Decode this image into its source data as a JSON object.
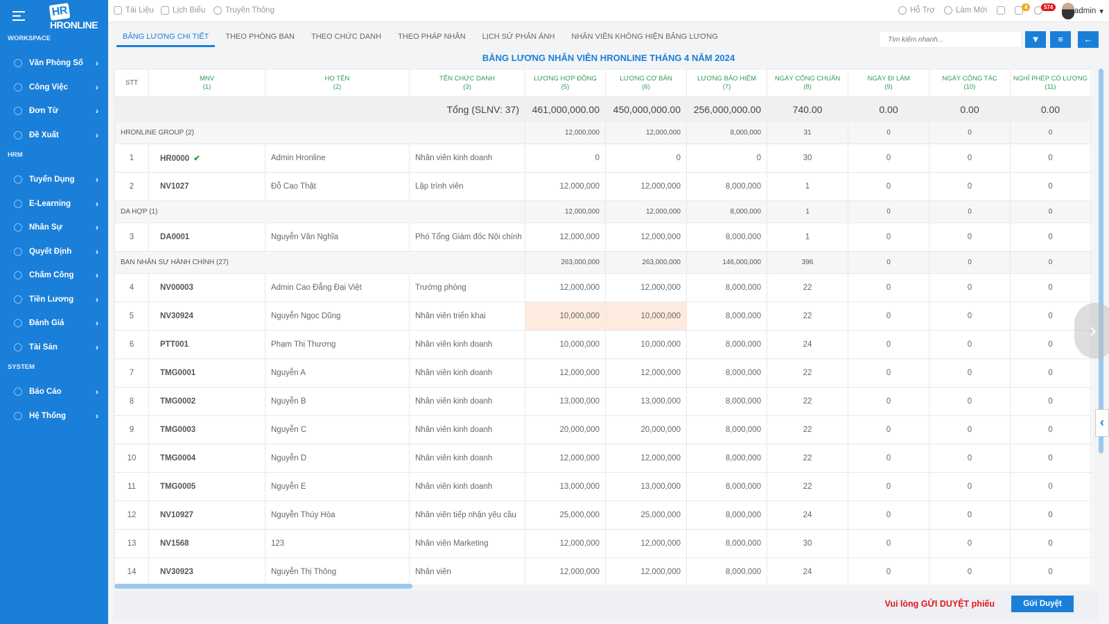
{
  "sidebar": {
    "logo": "HRONLINE",
    "sections": [
      {
        "title": "WORKSPACE",
        "items": [
          "Văn Phòng Số",
          "Công Việc",
          "Đơn Từ",
          "Đề Xuất"
        ]
      },
      {
        "title": "HRM",
        "items": [
          "Tuyển Dụng",
          "E-Learning",
          "Nhân Sự",
          "Quyết Định",
          "Chấm Công",
          "Tiền Lương",
          "Đánh Giá",
          "Tài Sản"
        ]
      },
      {
        "title": "SYSTEM",
        "items": [
          "Báo Cáo",
          "Hệ Thống"
        ]
      }
    ]
  },
  "topbar": {
    "links": [
      "Tài Liệu",
      "Lịch Biểu",
      "Truyền Thông"
    ],
    "support": "Hỗ Trợ",
    "refresh": "Làm Mới",
    "messages_count": "4",
    "notifications_count": "574",
    "user": "admin"
  },
  "tabs": [
    "BẢNG LƯƠNG CHI TIẾT",
    "THEO PHÒNG BAN",
    "THEO CHỨC DANH",
    "THEO PHÁP NHÂN",
    "LỊCH SỬ PHẢN ÁNH",
    "NHÂN VIÊN KHÔNG HIỆN BẢNG LƯƠNG"
  ],
  "active_tab": 0,
  "search": {
    "placeholder": "Tìm kiếm nhanh..."
  },
  "title": "BẢNG LƯƠNG NHÂN VIÊN HRONLINE THÁNG 4 NĂM 2024",
  "columns": [
    [
      "STT",
      ""
    ],
    [
      "MNV",
      "(1)"
    ],
    [
      "HỌ TÊN",
      "(2)"
    ],
    [
      "TÊN CHỨC DANH",
      "(3)"
    ],
    [
      "LƯƠNG HỢP ĐỒNG",
      "(5)"
    ],
    [
      "LƯƠNG CƠ BẢN",
      "(6)"
    ],
    [
      "LƯƠNG BẢO HIỂM",
      "(7)"
    ],
    [
      "NGÀY CÔNG CHUẨN",
      "(8)"
    ],
    [
      "NGÀY ĐI LÀM",
      "(9)"
    ],
    [
      "NGÀY CÔNG TÁC",
      "(10)"
    ],
    [
      "NGHỈ PHÉP CÓ LƯƠNG",
      "(11)"
    ]
  ],
  "total": {
    "label": "Tổng (SLNV: 37)",
    "values": [
      "461,000,000.00",
      "450,000,000.00",
      "256,000,000.00",
      "740.00",
      "0.00",
      "0.00",
      "0.00"
    ]
  },
  "rows": [
    {
      "group": "HRONLINE GROUP (2)",
      "values": [
        "12,000,000",
        "12,000,000",
        "8,000,000",
        "31",
        "0",
        "0",
        "0"
      ]
    },
    {
      "stt": "1",
      "mnv": "HR0000",
      "verified": true,
      "name": "Admin Hronline",
      "title": "Nhân viên kinh doanh",
      "values": [
        "0",
        "0",
        "0",
        "30",
        "0",
        "0",
        "0"
      ]
    },
    {
      "stt": "2",
      "mnv": "NV1027",
      "name": "Đỗ Cao Thật",
      "title": "Lập trình viên",
      "values": [
        "12,000,000",
        "12,000,000",
        "8,000,000",
        "1",
        "0",
        "0",
        "0"
      ]
    },
    {
      "group": "DA HỢP (1)",
      "values": [
        "12,000,000",
        "12,000,000",
        "8,000,000",
        "1",
        "0",
        "0",
        "0"
      ]
    },
    {
      "stt": "3",
      "mnv": "DA0001",
      "name": "Nguyễn Văn Nghĩa",
      "title": "Phó Tổng Giám đốc Nội chính",
      "values": [
        "12,000,000",
        "12,000,000",
        "8,000,000",
        "1",
        "0",
        "0",
        "0"
      ]
    },
    {
      "group": "BAN NHÂN SỰ HÀNH CHÍNH (27)",
      "values": [
        "263,000,000",
        "263,000,000",
        "146,000,000",
        "396",
        "0",
        "0",
        "0"
      ]
    },
    {
      "stt": "4",
      "mnv": "NV00003",
      "name": "Admin Cao Đẳng Đại Việt",
      "title": "Trưởng phòng",
      "values": [
        "12,000,000",
        "12,000,000",
        "8,000,000",
        "22",
        "0",
        "0",
        "0"
      ]
    },
    {
      "stt": "5",
      "mnv": "NV30924",
      "name": "Nguyễn Ngọc Dũng",
      "title": "Nhân viên triển khai",
      "highlight": true,
      "values": [
        "10,000,000",
        "10,000,000",
        "8,000,000",
        "22",
        "0",
        "0",
        "0"
      ]
    },
    {
      "stt": "6",
      "mnv": "PTT001",
      "name": "Phạm Thị Thương",
      "title": "Nhân viên kinh doanh",
      "values": [
        "10,000,000",
        "10,000,000",
        "8,000,000",
        "24",
        "0",
        "0",
        "0"
      ]
    },
    {
      "stt": "7",
      "mnv": "TMG0001",
      "name": "Nguyễn A",
      "title": "Nhân viên kinh doanh",
      "values": [
        "12,000,000",
        "12,000,000",
        "8,000,000",
        "22",
        "0",
        "0",
        "0"
      ]
    },
    {
      "stt": "8",
      "mnv": "TMG0002",
      "name": "Nguyễn B",
      "title": "Nhân viên kinh doanh",
      "values": [
        "13,000,000",
        "13,000,000",
        "8,000,000",
        "22",
        "0",
        "0",
        "0"
      ]
    },
    {
      "stt": "9",
      "mnv": "TMG0003",
      "name": "Nguyễn C",
      "title": "Nhân viên kinh doanh",
      "values": [
        "20,000,000",
        "20,000,000",
        "8,000,000",
        "22",
        "0",
        "0",
        "0"
      ]
    },
    {
      "stt": "10",
      "mnv": "TMG0004",
      "name": "Nguyễn D",
      "title": "Nhân viên kinh doanh",
      "values": [
        "12,000,000",
        "12,000,000",
        "8,000,000",
        "22",
        "0",
        "0",
        "0"
      ]
    },
    {
      "stt": "11",
      "mnv": "TMG0005",
      "name": "Nguyễn E",
      "title": "Nhân viên kinh doanh",
      "values": [
        "13,000,000",
        "13,000,000",
        "8,000,000",
        "22",
        "0",
        "0",
        "0"
      ]
    },
    {
      "stt": "12",
      "mnv": "NV10927",
      "name": "Nguyễn Thúy Hòa",
      "title": "Nhân viên tiếp nhận yêu cầu",
      "values": [
        "25,000,000",
        "25,000,000",
        "8,000,000",
        "24",
        "0",
        "0",
        "0"
      ]
    },
    {
      "stt": "13",
      "mnv": "NV1568",
      "name": "123",
      "title": "Nhân viên Marketing",
      "values": [
        "12,000,000",
        "12,000,000",
        "8,000,000",
        "30",
        "0",
        "0",
        "0"
      ]
    },
    {
      "stt": "14",
      "mnv": "NV30923",
      "name": "Nguyễn Thị Thông",
      "title": "Nhân viên",
      "values": [
        "12,000,000",
        "12,000,000",
        "8,000,000",
        "24",
        "0",
        "0",
        "0"
      ]
    }
  ],
  "footer": {
    "warning": "Vui lòng GỬI DUYỆT phiếu",
    "submit": "Gửi Duyệt"
  },
  "colors": {
    "primary": "#1a7fd9",
    "header_text": "#2e9a55",
    "warning": "#e3161e",
    "highlight_row": "#fdebdf"
  }
}
